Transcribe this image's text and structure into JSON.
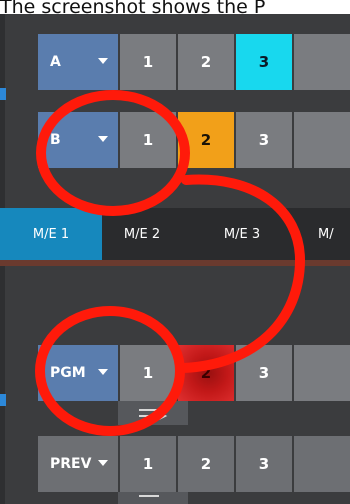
{
  "caption": {
    "text": "The screenshot shows the P"
  },
  "rows": [
    {
      "selector": "A",
      "buttons": [
        "1",
        "2",
        "3"
      ],
      "active_index": 2,
      "active_color": "#18d8ee"
    },
    {
      "selector": "B",
      "buttons": [
        "1",
        "2",
        "3"
      ],
      "active_index": 1,
      "active_color": "#f2a019"
    },
    {
      "selector": "PGM",
      "buttons": [
        "1",
        "2",
        "3"
      ],
      "active_index": 1,
      "active_color": "#c21818"
    },
    {
      "selector": "PREV",
      "buttons": [
        "1",
        "2",
        "3"
      ],
      "active_index": null
    }
  ],
  "tabs": {
    "items": [
      "M/E 1",
      "M/E 2",
      "M/E 3",
      "M/"
    ],
    "active_index": 0,
    "active_color": "#1688bd"
  },
  "colors": {
    "annotation_red": "#ff1a0a",
    "selector_blue": "#5a7dae"
  },
  "icons": {
    "transition_indicator": "transition-arrow-icon"
  }
}
